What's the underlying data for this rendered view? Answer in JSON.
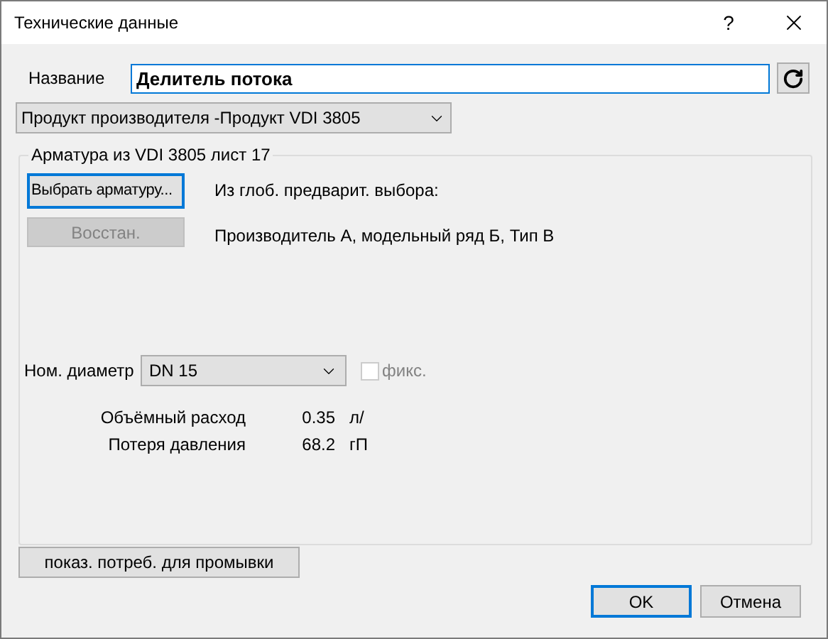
{
  "window": {
    "title": "Технические данные",
    "help": "?"
  },
  "name": {
    "label": "Название",
    "value": "Делитель потока"
  },
  "source_dropdown": {
    "value": "Продукт производителя -Продукт VDI 3805"
  },
  "group": {
    "title": "Арматура из VDI 3805 лист 17",
    "select_button": {
      "label": "Выбрать арматуру...",
      "focused": true
    },
    "restore_button": {
      "label": "Восстан.",
      "disabled": true
    },
    "info_heading": "Из глоб. предварит. выбора:",
    "info_text": "Производитель А, модельный ряд Б, Тип В",
    "diameter": {
      "label": "Ном. диаметр",
      "value": "DN 15"
    },
    "fixed": {
      "label": "фикс.",
      "checked": false,
      "disabled": true
    },
    "values": [
      {
        "label": "Объёмный расход",
        "value": "0.35",
        "unit": "л/"
      },
      {
        "label": "Потеря давления",
        "value": "68.2",
        "unit": "гП"
      }
    ]
  },
  "flush_button": {
    "label": "показ. потреб. для промывки"
  },
  "buttons": [
    {
      "label": "OK",
      "focused": true
    },
    {
      "label": "Отмена",
      "focused": false
    }
  ]
}
